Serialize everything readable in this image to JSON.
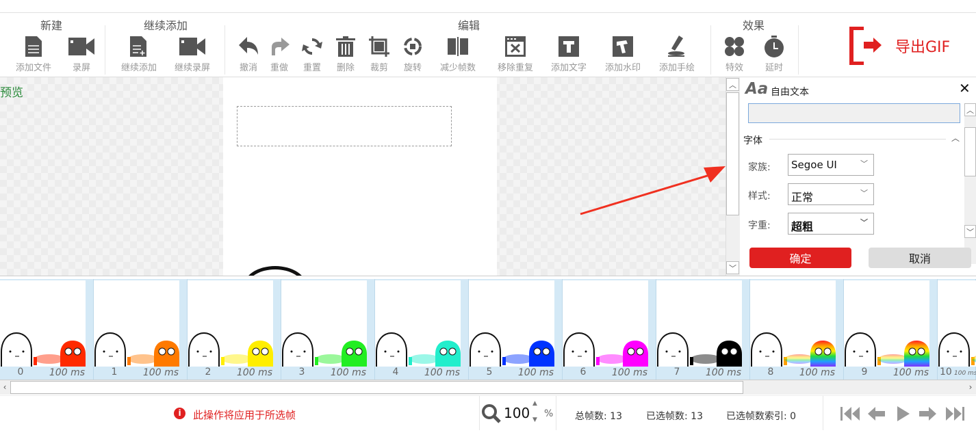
{
  "toolbar": {
    "groups": {
      "new": "新建",
      "continue": "继续添加",
      "edit": "编辑",
      "effects": "效果"
    },
    "tools": {
      "add_file": "添加文件",
      "record": "录屏",
      "continue_add": "继续添加",
      "continue_record": "继续录屏",
      "undo": "撤消",
      "redo": "重做",
      "reset": "重置",
      "delete": "删除",
      "crop": "裁剪",
      "rotate": "旋转",
      "reduce_frames": "减少帧数",
      "remove_duplicates": "移除重复",
      "add_text": "添加文字",
      "add_watermark": "添加水印",
      "add_drawing": "添加手绘",
      "effects": "特效",
      "delay": "延时"
    },
    "export_label": "导出GIF",
    "accent": "#e02020"
  },
  "preview": {
    "label": "预览"
  },
  "text_panel": {
    "icon_text": "Aa",
    "title": "自由文本",
    "text_value": "",
    "section_font": "字体",
    "family_label": "家族:",
    "family_value": "Segoe UI",
    "style_label": "样式:",
    "style_value": "正常",
    "weight_label": "字重:",
    "weight_value": "超粗",
    "confirm": "确定",
    "cancel": "取消"
  },
  "frames": [
    {
      "index": "0",
      "duration": "100 ms",
      "color": "#ff2a00"
    },
    {
      "index": "1",
      "duration": "100 ms",
      "color": "#ff7a00"
    },
    {
      "index": "2",
      "duration": "100 ms",
      "color": "#ffee00"
    },
    {
      "index": "3",
      "duration": "100 ms",
      "color": "#22ee22"
    },
    {
      "index": "4",
      "duration": "100 ms",
      "color": "#22eecc"
    },
    {
      "index": "5",
      "duration": "100 ms",
      "color": "#0033ff"
    },
    {
      "index": "6",
      "duration": "100 ms",
      "color": "#ff00ff"
    },
    {
      "index": "7",
      "duration": "100 ms",
      "color": "#000000"
    },
    {
      "index": "8",
      "duration": "100 ms",
      "color": "rainbow"
    },
    {
      "index": "9",
      "duration": "100 ms",
      "color": "rainbow"
    },
    {
      "index": "10",
      "duration": "100 ms",
      "color": "rainbow"
    }
  ],
  "status": {
    "warning": "此操作将应用于所选帧",
    "zoom_value": "100",
    "zoom_unit": "%",
    "total_frames": "总帧数: 13",
    "selected_frames": "已选帧数: 13",
    "selected_index": "已选帧数索引: 0"
  }
}
